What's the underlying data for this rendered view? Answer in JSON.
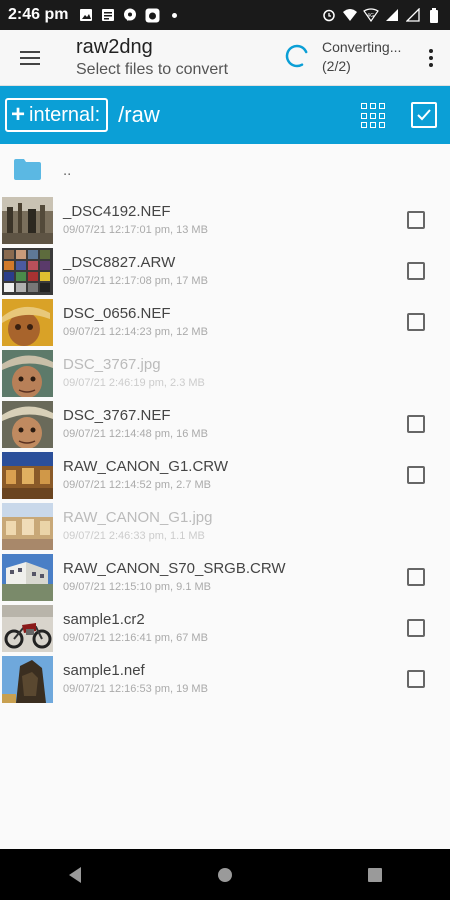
{
  "status_bar": {
    "time": "2:46 pm",
    "left_icons": [
      "image-icon",
      "news-icon",
      "chat-icon",
      "app-icon",
      "dot-icon"
    ],
    "right_icons": [
      "alarm-icon",
      "wifi-icon",
      "volte-icon",
      "signal-icon",
      "signal2-icon",
      "battery-icon"
    ]
  },
  "app_bar": {
    "title": "raw2dng",
    "subtitle": "Select files to convert",
    "progress_label": "Converting...",
    "progress_count": "(2/2)"
  },
  "path_bar": {
    "storage_label": "internal:",
    "path": "/raw"
  },
  "parent": {
    "label": ".."
  },
  "files": [
    {
      "name": "_DSC4192.NEF",
      "meta": "09/07/21 12:17:01 pm, 13 MB",
      "enabled": true
    },
    {
      "name": "_DSC8827.ARW",
      "meta": "09/07/21 12:17:08 pm, 17 MB",
      "enabled": true
    },
    {
      "name": "DSC_0656.NEF",
      "meta": "09/07/21 12:14:23 pm, 12 MB",
      "enabled": true
    },
    {
      "name": "DSC_3767.jpg",
      "meta": "09/07/21 2:46:19 pm, 2.3 MB",
      "enabled": false
    },
    {
      "name": "DSC_3767.NEF",
      "meta": "09/07/21 12:14:48 pm, 16 MB",
      "enabled": true
    },
    {
      "name": "RAW_CANON_G1.CRW",
      "meta": "09/07/21 12:14:52 pm, 2.7 MB",
      "enabled": true
    },
    {
      "name": "RAW_CANON_G1.jpg",
      "meta": "09/07/21 2:46:33 pm, 1.1 MB",
      "enabled": false
    },
    {
      "name": "RAW_CANON_S70_SRGB.CRW",
      "meta": "09/07/21 12:15:10 pm, 9.1 MB",
      "enabled": true
    },
    {
      "name": "sample1.cr2",
      "meta": "09/07/21 12:16:41 pm, 67 MB",
      "enabled": true
    },
    {
      "name": "sample1.nef",
      "meta": "09/07/21 12:16:53 pm, 19 MB",
      "enabled": true
    }
  ],
  "colors": {
    "accent": "#0b9fd6",
    "folder": "#5bb8e3"
  }
}
